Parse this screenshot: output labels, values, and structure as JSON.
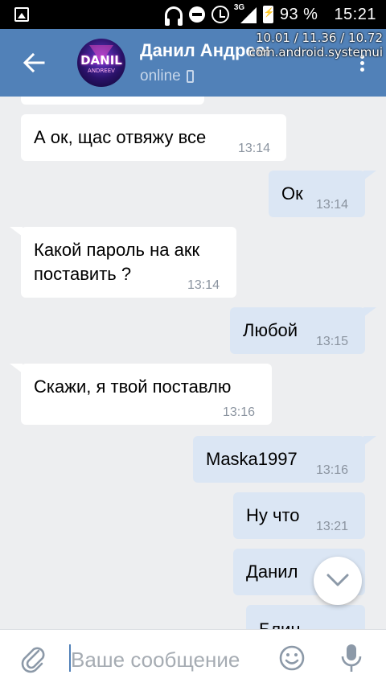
{
  "status_bar": {
    "network": "3G",
    "battery": "93 %",
    "clock": "15:21"
  },
  "overlay": {
    "line1": "10.01 / 11.36 / 10.72",
    "line2": "com.android.systemui"
  },
  "header": {
    "name": "Данил Андреев",
    "status": "online",
    "avatar_text": "DANIL",
    "avatar_sub": "ANDREEV",
    "bg_color": "#5181b8"
  },
  "messages": [
    {
      "dir": "in",
      "text": "А ок, щас отвяжу все",
      "time": "13:14"
    },
    {
      "dir": "out",
      "text": "Ок",
      "time": "13:14"
    },
    {
      "dir": "in",
      "text": "Какой пароль на акк\nпоставить ?",
      "time": "13:14"
    },
    {
      "dir": "out",
      "text": "Любой",
      "time": "13:15"
    },
    {
      "dir": "in",
      "text": "Скажи, я твой поставлю",
      "time": "13:16"
    },
    {
      "dir": "out",
      "text": "Maska1997",
      "time": "13:16"
    },
    {
      "dir": "out",
      "text": "Ну что",
      "time": "13:21"
    },
    {
      "dir": "out",
      "text": "Данил",
      "time": ""
    },
    {
      "dir": "out",
      "text": "Блин",
      "time": ""
    }
  ],
  "composer": {
    "placeholder": "Ваше сообщение"
  },
  "icons": {
    "back": "arrow-left-icon",
    "menu": "more-vertical-icon",
    "attach": "paperclip-icon",
    "emoji": "smile-icon",
    "mic": "microphone-icon",
    "scroll": "chevron-down-icon"
  }
}
